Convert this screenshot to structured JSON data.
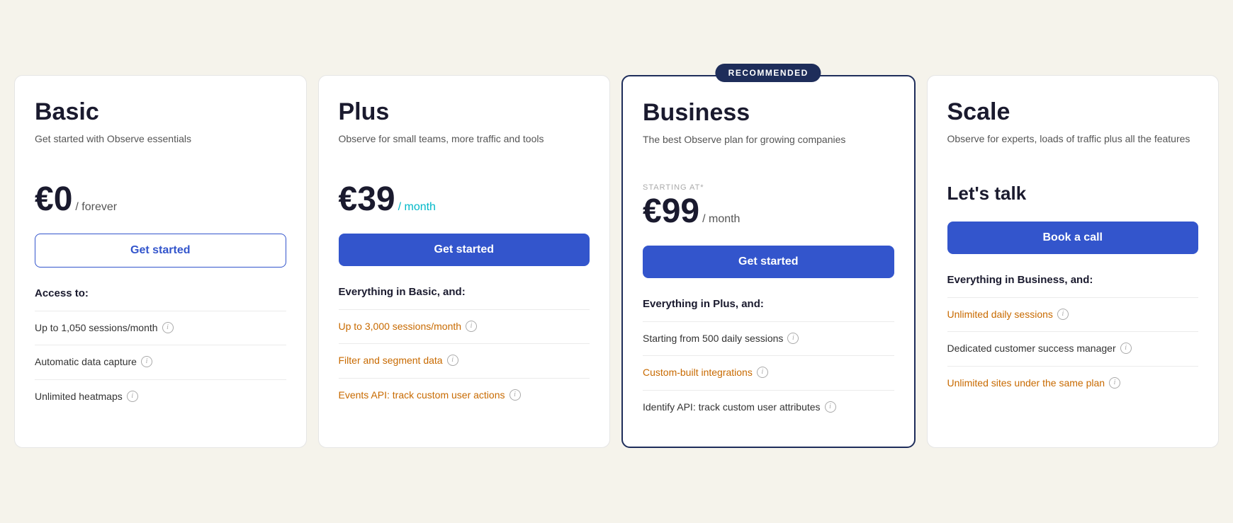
{
  "plans": [
    {
      "id": "basic",
      "name": "Basic",
      "description": "Get started with Observe essentials",
      "starting_at": null,
      "price": "€0",
      "period": "/ forever",
      "period_class": "",
      "cta_label": "Get started",
      "cta_style": "outline",
      "recommended": false,
      "recommended_label": null,
      "lets_talk": null,
      "features_heading": "Access to:",
      "features": [
        {
          "text": "Up to 1,050 sessions/month",
          "info": true,
          "orange": false
        },
        {
          "text": "Automatic data capture",
          "info": true,
          "orange": false
        },
        {
          "text": "Unlimited heatmaps",
          "info": true,
          "orange": false
        }
      ]
    },
    {
      "id": "plus",
      "name": "Plus",
      "description": "Observe for small teams, more traffic and tools",
      "starting_at": null,
      "price": "€39",
      "period": "/ month",
      "period_class": "cyan",
      "cta_label": "Get started",
      "cta_style": "solid",
      "recommended": false,
      "recommended_label": null,
      "lets_talk": null,
      "features_heading": "Everything in Basic, and:",
      "features": [
        {
          "text": "Up to 3,000 sessions/month",
          "info": true,
          "orange": true
        },
        {
          "text": "Filter and segment data",
          "info": true,
          "orange": true
        },
        {
          "text": "Events API: track custom user actions",
          "info": true,
          "orange": true
        }
      ]
    },
    {
      "id": "business",
      "name": "Business",
      "description": "The best Observe plan for growing companies",
      "starting_at": "STARTING AT*",
      "price": "€99",
      "period": "/ month",
      "period_class": "",
      "cta_label": "Get started",
      "cta_style": "solid",
      "recommended": true,
      "recommended_label": "RECOMMENDED",
      "lets_talk": null,
      "features_heading": "Everything in Plus, and:",
      "features": [
        {
          "text": "Starting from 500 daily sessions",
          "info": true,
          "orange": false
        },
        {
          "text": "Custom-built integrations",
          "info": true,
          "orange": true
        },
        {
          "text": "Identify API: track custom user attributes",
          "info": true,
          "orange": false
        }
      ]
    },
    {
      "id": "scale",
      "name": "Scale",
      "description": "Observe for experts, loads of traffic plus all the features",
      "starting_at": null,
      "price": null,
      "period": null,
      "period_class": "",
      "cta_label": "Book a call",
      "cta_style": "solid",
      "recommended": false,
      "recommended_label": null,
      "lets_talk": "Let's talk",
      "features_heading": "Everything in Business, and:",
      "features": [
        {
          "text": "Unlimited daily sessions",
          "info": true,
          "orange": true
        },
        {
          "text": "Dedicated customer success manager",
          "info": true,
          "orange": false
        },
        {
          "text": "Unlimited sites under the same plan",
          "info": true,
          "orange": true
        }
      ]
    }
  ]
}
